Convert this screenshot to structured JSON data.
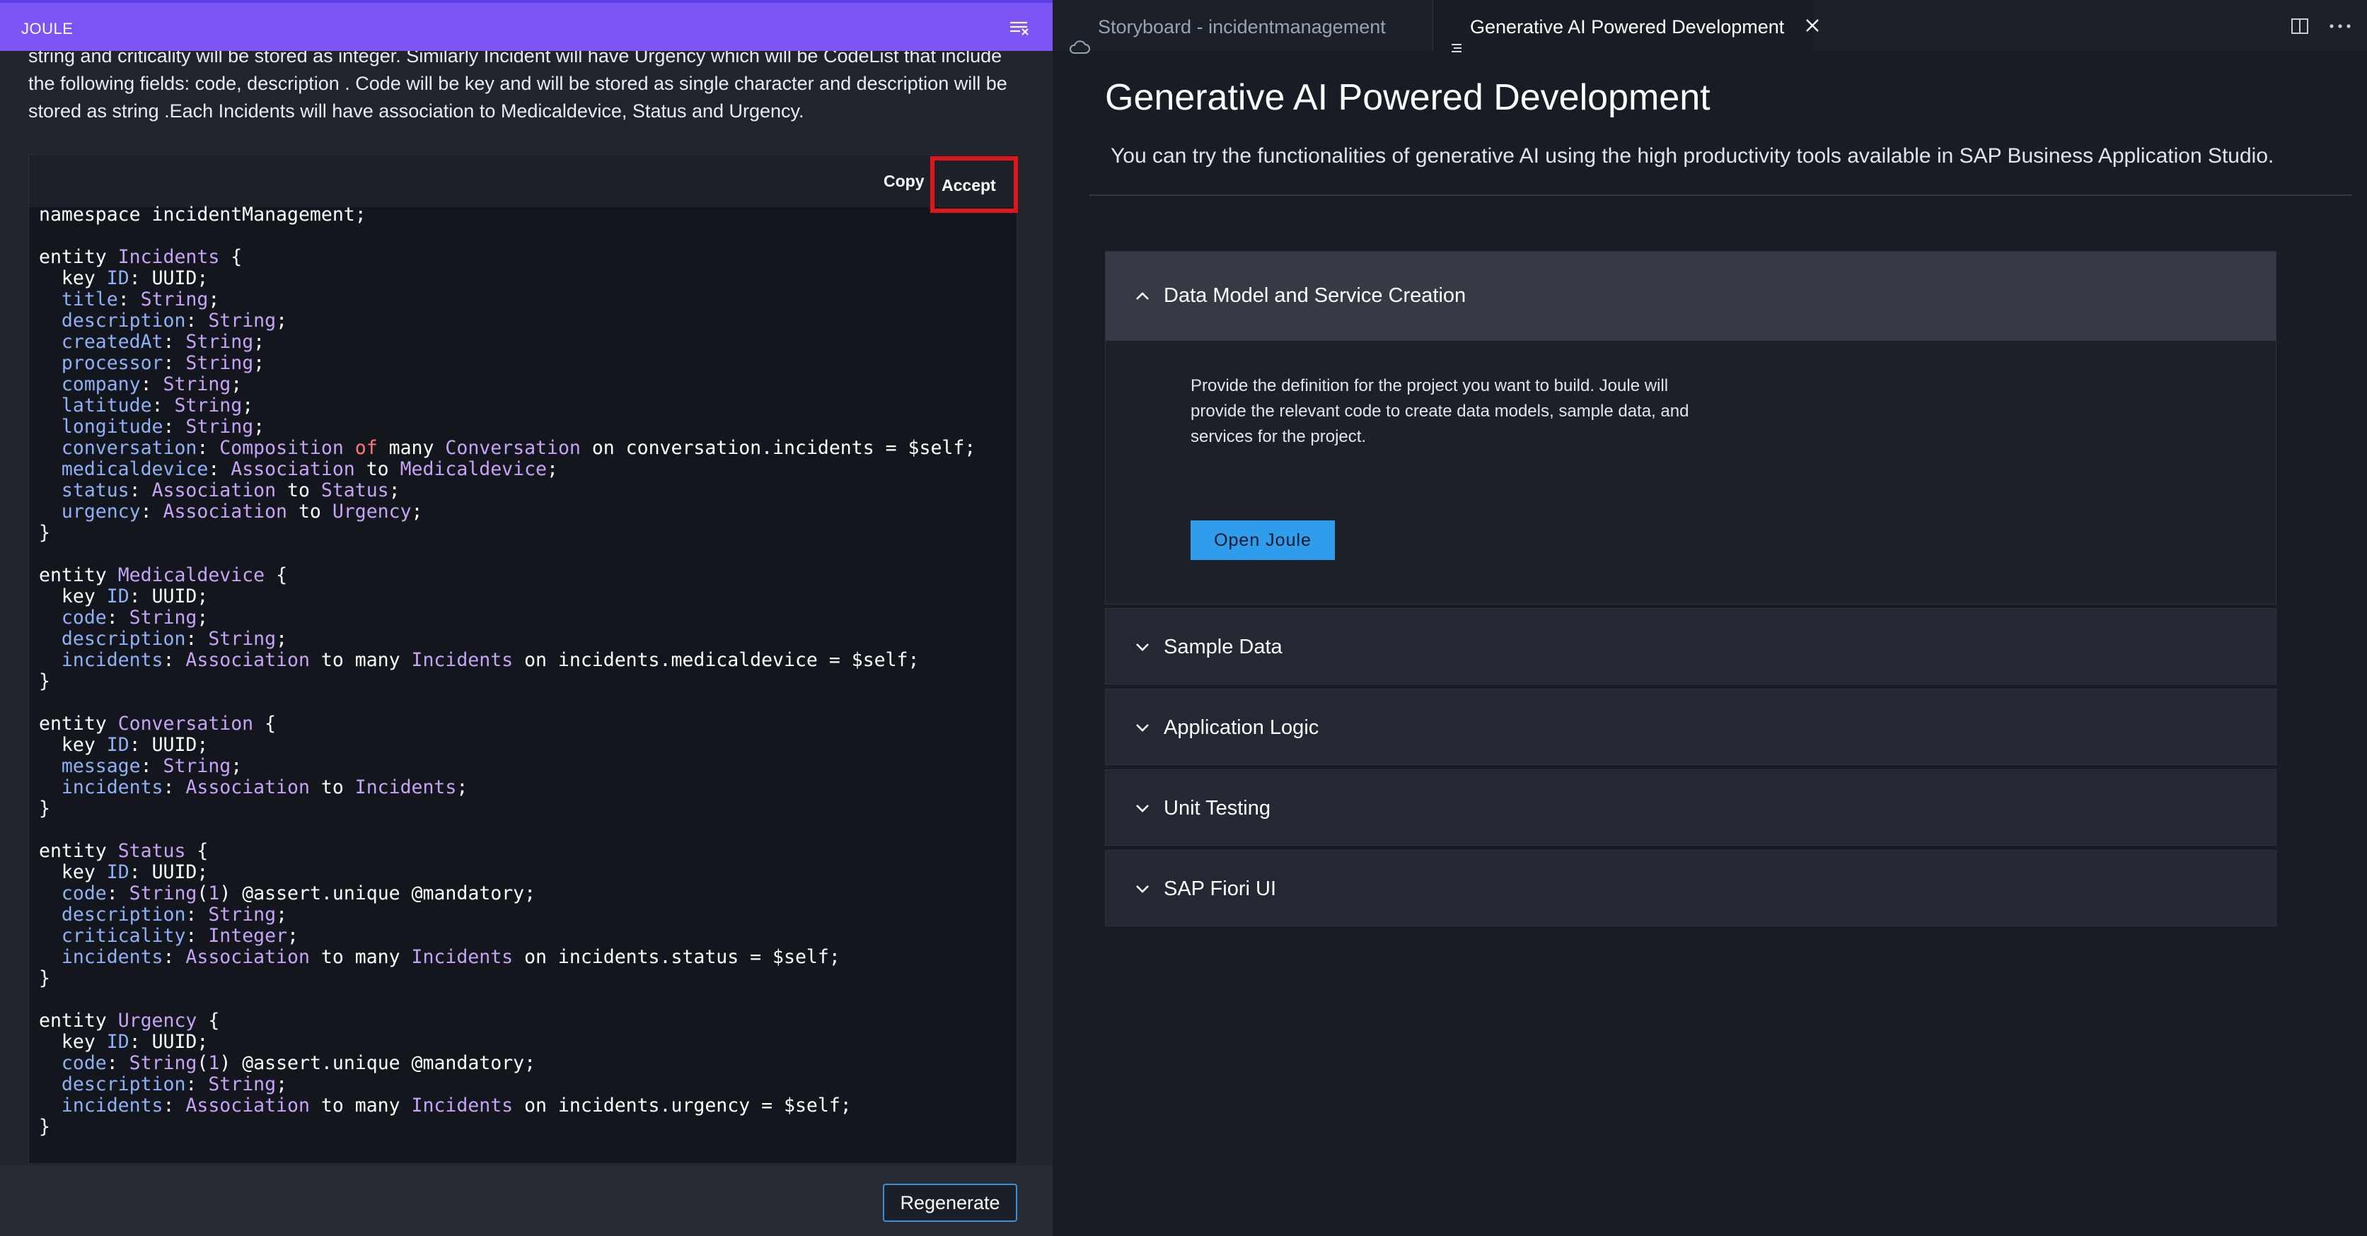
{
  "joule": {
    "title": "JOULE",
    "prompt_text": "string and criticality will be stored as integer. Similarly Incident will have Urgency which will be CodeList that include the following fields: code, description . Code will be key and will be stored as single character and description will be stored as string .Each Incidents will have association to Medicaldevice, Status and Urgency.",
    "copy_label": "Copy",
    "accept_label": "Accept",
    "regenerate_label": "Regenerate",
    "code_lines": [
      [
        [
          "kw",
          "namespace incidentManagement;"
        ]
      ],
      [],
      [
        [
          "kw",
          "entity "
        ],
        [
          "ty",
          "Incidents"
        ],
        [
          "kw",
          " {"
        ]
      ],
      [
        [
          "kw",
          "  key "
        ],
        [
          "fd",
          "ID"
        ],
        [
          "kw",
          ": UUID;"
        ]
      ],
      [
        [
          "fd",
          "  title"
        ],
        [
          "kw",
          ": "
        ],
        [
          "ty",
          "String"
        ],
        [
          "kw",
          ";"
        ]
      ],
      [
        [
          "fd",
          "  description"
        ],
        [
          "kw",
          ": "
        ],
        [
          "ty",
          "String"
        ],
        [
          "kw",
          ";"
        ]
      ],
      [
        [
          "fd",
          "  createdAt"
        ],
        [
          "kw",
          ": "
        ],
        [
          "ty",
          "String"
        ],
        [
          "kw",
          ";"
        ]
      ],
      [
        [
          "fd",
          "  processor"
        ],
        [
          "kw",
          ": "
        ],
        [
          "ty",
          "String"
        ],
        [
          "kw",
          ";"
        ]
      ],
      [
        [
          "fd",
          "  company"
        ],
        [
          "kw",
          ": "
        ],
        [
          "ty",
          "String"
        ],
        [
          "kw",
          ";"
        ]
      ],
      [
        [
          "fd",
          "  latitude"
        ],
        [
          "kw",
          ": "
        ],
        [
          "ty",
          "String"
        ],
        [
          "kw",
          ";"
        ]
      ],
      [
        [
          "fd",
          "  longitude"
        ],
        [
          "kw",
          ": "
        ],
        [
          "ty",
          "String"
        ],
        [
          "kw",
          ";"
        ]
      ],
      [
        [
          "fd",
          "  conversation"
        ],
        [
          "kw",
          ": "
        ],
        [
          "ty",
          "Composition"
        ],
        [
          "of",
          " of"
        ],
        [
          "kw",
          " many "
        ],
        [
          "ty",
          "Conversation"
        ],
        [
          "kw",
          " on conversation.incidents = $self;"
        ]
      ],
      [
        [
          "fd",
          "  medicaldevice"
        ],
        [
          "kw",
          ": "
        ],
        [
          "ty",
          "Association"
        ],
        [
          "kw",
          " to "
        ],
        [
          "ty",
          "Medicaldevice"
        ],
        [
          "kw",
          ";"
        ]
      ],
      [
        [
          "fd",
          "  status"
        ],
        [
          "kw",
          ": "
        ],
        [
          "ty",
          "Association"
        ],
        [
          "kw",
          " to "
        ],
        [
          "ty",
          "Status"
        ],
        [
          "kw",
          ";"
        ]
      ],
      [
        [
          "fd",
          "  urgency"
        ],
        [
          "kw",
          ": "
        ],
        [
          "ty",
          "Association"
        ],
        [
          "kw",
          " to "
        ],
        [
          "ty",
          "Urgency"
        ],
        [
          "kw",
          ";"
        ]
      ],
      [
        [
          "kw",
          "}"
        ]
      ],
      [],
      [
        [
          "kw",
          "entity "
        ],
        [
          "ty",
          "Medicaldevice"
        ],
        [
          "kw",
          " {"
        ]
      ],
      [
        [
          "kw",
          "  key "
        ],
        [
          "fd",
          "ID"
        ],
        [
          "kw",
          ": UUID;"
        ]
      ],
      [
        [
          "fd",
          "  code"
        ],
        [
          "kw",
          ": "
        ],
        [
          "ty",
          "String"
        ],
        [
          "kw",
          ";"
        ]
      ],
      [
        [
          "fd",
          "  description"
        ],
        [
          "kw",
          ": "
        ],
        [
          "ty",
          "String"
        ],
        [
          "kw",
          ";"
        ]
      ],
      [
        [
          "fd",
          "  incidents"
        ],
        [
          "kw",
          ": "
        ],
        [
          "ty",
          "Association"
        ],
        [
          "kw",
          " to many "
        ],
        [
          "ty",
          "Incidents"
        ],
        [
          "kw",
          " on incidents.medicaldevice = $self;"
        ]
      ],
      [
        [
          "kw",
          "}"
        ]
      ],
      [],
      [
        [
          "kw",
          "entity "
        ],
        [
          "ty",
          "Conversation"
        ],
        [
          "kw",
          " {"
        ]
      ],
      [
        [
          "kw",
          "  key "
        ],
        [
          "fd",
          "ID"
        ],
        [
          "kw",
          ": UUID;"
        ]
      ],
      [
        [
          "fd",
          "  message"
        ],
        [
          "kw",
          ": "
        ],
        [
          "ty",
          "String"
        ],
        [
          "kw",
          ";"
        ]
      ],
      [
        [
          "fd",
          "  incidents"
        ],
        [
          "kw",
          ": "
        ],
        [
          "ty",
          "Association"
        ],
        [
          "kw",
          " to "
        ],
        [
          "ty",
          "Incidents"
        ],
        [
          "kw",
          ";"
        ]
      ],
      [
        [
          "kw",
          "}"
        ]
      ],
      [],
      [
        [
          "kw",
          "entity "
        ],
        [
          "ty",
          "Status"
        ],
        [
          "kw",
          " {"
        ]
      ],
      [
        [
          "kw",
          "  key "
        ],
        [
          "fd",
          "ID"
        ],
        [
          "kw",
          ": UUID;"
        ]
      ],
      [
        [
          "fd",
          "  code"
        ],
        [
          "kw",
          ": "
        ],
        [
          "ty",
          "String"
        ],
        [
          "kw",
          "("
        ],
        [
          "ty",
          "1"
        ],
        [
          "kw",
          ") @assert.unique @mandatory;"
        ]
      ],
      [
        [
          "fd",
          "  description"
        ],
        [
          "kw",
          ": "
        ],
        [
          "ty",
          "String"
        ],
        [
          "kw",
          ";"
        ]
      ],
      [
        [
          "fd",
          "  criticality"
        ],
        [
          "kw",
          ": "
        ],
        [
          "ty",
          "Integer"
        ],
        [
          "kw",
          ";"
        ]
      ],
      [
        [
          "fd",
          "  incidents"
        ],
        [
          "kw",
          ": "
        ],
        [
          "ty",
          "Association"
        ],
        [
          "kw",
          " to many "
        ],
        [
          "ty",
          "Incidents"
        ],
        [
          "kw",
          " on incidents.status = $self;"
        ]
      ],
      [
        [
          "kw",
          "}"
        ]
      ],
      [],
      [
        [
          "kw",
          "entity "
        ],
        [
          "ty",
          "Urgency"
        ],
        [
          "kw",
          " {"
        ]
      ],
      [
        [
          "kw",
          "  key "
        ],
        [
          "fd",
          "ID"
        ],
        [
          "kw",
          ": UUID;"
        ]
      ],
      [
        [
          "fd",
          "  code"
        ],
        [
          "kw",
          ": "
        ],
        [
          "ty",
          "String"
        ],
        [
          "kw",
          "("
        ],
        [
          "ty",
          "1"
        ],
        [
          "kw",
          ") @assert.unique @mandatory;"
        ]
      ],
      [
        [
          "fd",
          "  description"
        ],
        [
          "kw",
          ": "
        ],
        [
          "ty",
          "String"
        ],
        [
          "kw",
          ";"
        ]
      ],
      [
        [
          "fd",
          "  incidents"
        ],
        [
          "kw",
          ": "
        ],
        [
          "ty",
          "Association"
        ],
        [
          "kw",
          " to many "
        ],
        [
          "ty",
          "Incidents"
        ],
        [
          "kw",
          " on incidents.urgency = $self;"
        ]
      ],
      [
        [
          "kw",
          "}"
        ]
      ]
    ],
    "menu_icon": "menu-icon"
  },
  "tabs": [
    {
      "label": "Storyboard - incidentmanagement",
      "icon": "cloud-icon",
      "active": false
    },
    {
      "label": "Generative AI Powered Development",
      "icon": "document-icon",
      "active": true
    }
  ],
  "editor": {
    "title": "Generative AI Powered Development",
    "description": "You can try the functionalities of generative AI using the high productivity tools available in SAP Business Application Studio.",
    "sections": [
      {
        "label": "Data Model and Service Creation",
        "expanded": true,
        "body": "Provide the definition for the project you want to build. Joule will provide the relevant code to create data models, sample data, and services for the project.",
        "button_label": "Open Joule"
      },
      {
        "label": "Sample Data",
        "expanded": false
      },
      {
        "label": "Application Logic",
        "expanded": false
      },
      {
        "label": "Unit Testing",
        "expanded": false
      },
      {
        "label": "SAP Fiori UI",
        "expanded": false
      }
    ]
  },
  "colors": {
    "joule_header": "#7c55f5",
    "accept_highlight": "#e0161b",
    "open_joule_button": "#2f9cec",
    "code_type": "#c7a3f5",
    "code_field": "#8fb0f5",
    "code_keyword_of": "#ff7b72"
  }
}
